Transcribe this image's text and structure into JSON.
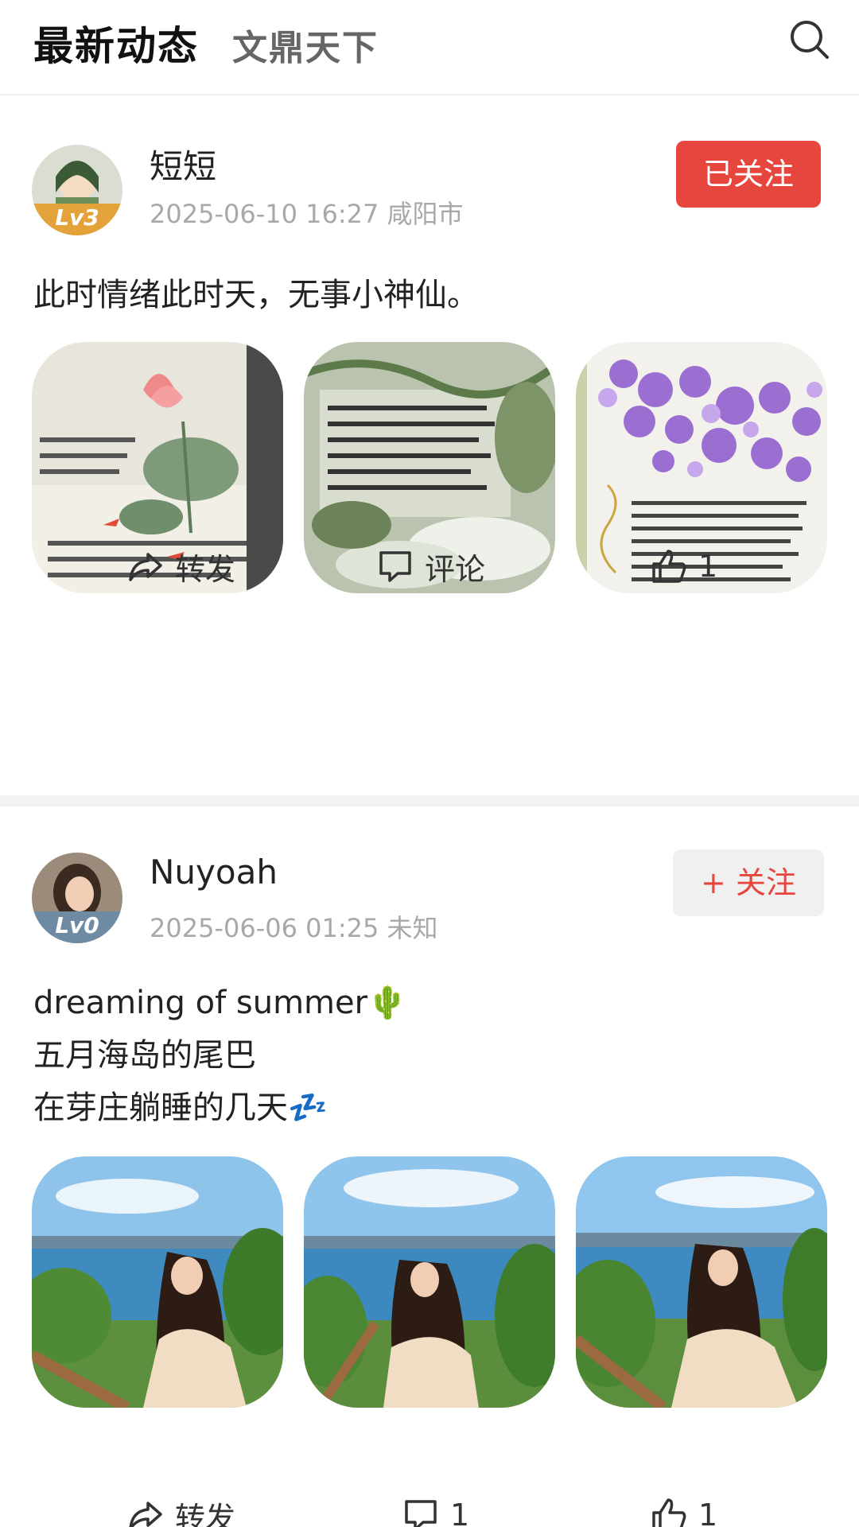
{
  "header": {
    "tab_active": "最新动态",
    "tab_inactive": "文鼎天下"
  },
  "posts": [
    {
      "username": "短短",
      "meta": "2025-06-10 16:27 咸阳市",
      "level": "Lv3",
      "follow_label": "已关注",
      "text_lines": [
        "此时情绪此时天，无事小神仙。"
      ],
      "actions": {
        "share": "转发",
        "comment": "评论",
        "like": "1"
      }
    },
    {
      "username": "Nuyoah",
      "meta": "2025-06-06 01:25 未知",
      "level": "Lv0",
      "follow_label": "+ 关注",
      "text_lines": [
        "dreaming of summer🌵",
        "五月海岛的尾巴",
        "在芽庄躺睡的几天💤"
      ],
      "actions": {
        "share": "转发",
        "comment": "1",
        "like": "1"
      }
    }
  ],
  "colors": {
    "accent_red": "#e6463e",
    "muted_text": "#a8a8a8"
  }
}
